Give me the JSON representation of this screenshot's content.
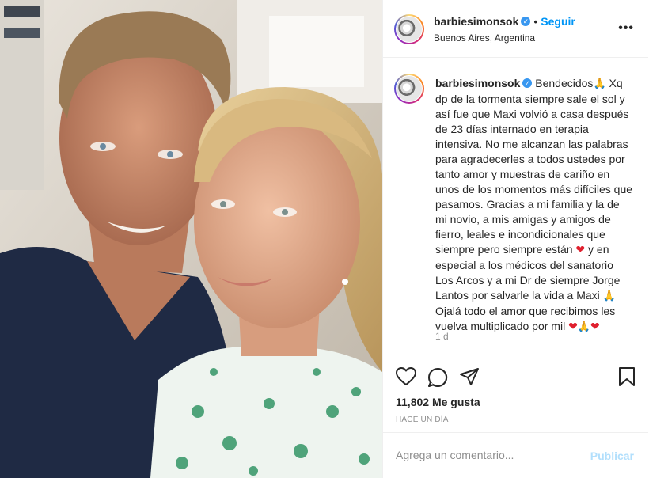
{
  "post": {
    "username": "barbiesimonsok",
    "verified": true,
    "separator": "•",
    "follow_label": "Seguir",
    "location": "Buenos Aires, Argentina",
    "more_options": "•••"
  },
  "caption": {
    "username": "barbiesimonsok",
    "text_1": " Bendecidos",
    "emoji_pray": "🙏",
    "text_2": " Xq dp de la tormenta siempre sale el sol y así fue que Maxi volvió a casa después de 23 días internado en terapia intensiva. No me alcanzan las palabras para agradecerles a todos ustedes por tanto amor y muestras de cariño en unos de los momentos más difíciles que pasamos. Gracias a mi familia y la de mi novio, a mis amigas y amigos de fierro, leales e incondicionales que siempre pero siempre están ",
    "emoji_heart": "❤",
    "text_3": " y en especial a los médicos del sanatorio Los Arcos y a mi Dr de siempre Jorge Lantos por salvarle la vida a Maxi ",
    "text_4": "\nOjalá todo el amor que recibimos les vuelva multiplicado por mil ",
    "time": "1 d"
  },
  "stats": {
    "likes": "11,802 Me gusta",
    "posted": "Hace un día"
  },
  "comment_box": {
    "placeholder": "Agrega un comentario...",
    "publish_label": "Publicar"
  },
  "colors": {
    "link_blue": "#0095f6",
    "publish_disabled": "#b2dffc",
    "verified_blue": "#3897f0",
    "heart_red": "#e0202e"
  }
}
